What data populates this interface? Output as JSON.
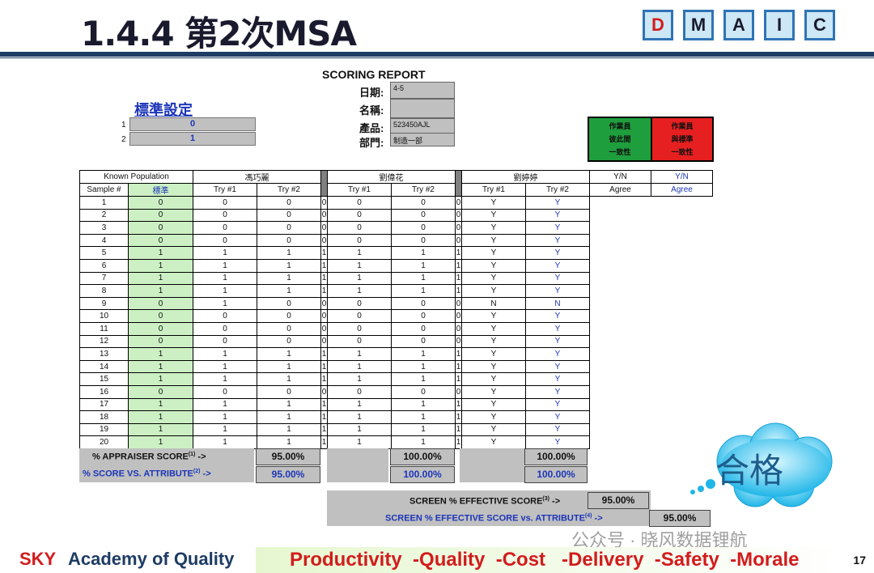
{
  "slide": {
    "title": "1.4.4 第2次MSA",
    "dmaic": [
      "D",
      "M",
      "A",
      "I",
      "C"
    ],
    "page_number": "17"
  },
  "report": {
    "heading": "SCORING REPORT",
    "date_label": "日期:",
    "date_value": "4-5",
    "name_label": "名稱:",
    "name_value": "",
    "product_label": "產品:",
    "product_value": "523450AJL",
    "dept_label": "部門:",
    "dept_value": "制造一部"
  },
  "standard": {
    "title": "標準設定",
    "rows": [
      {
        "index": "1",
        "value": "0"
      },
      {
        "index": "2",
        "value": "1"
      }
    ]
  },
  "legend": {
    "agree": "作業員\n彼此間\n一致性",
    "vs_standard": "作業員\n與標準\n一致性"
  },
  "table": {
    "known_population": "Known Population",
    "sample_header": "Sample #",
    "standard_header": "標準",
    "appraisers": [
      "馮巧麗",
      "劉偉花",
      "劉婷婷"
    ],
    "try1": "Try #1",
    "try2": "Try #2",
    "yn_header": "Y/N",
    "agree_header": "Agree",
    "rows": [
      [
        "1",
        "0",
        "0",
        "0",
        "0",
        "0",
        "0",
        "0",
        "Y",
        "Y"
      ],
      [
        "2",
        "0",
        "0",
        "0",
        "0",
        "0",
        "0",
        "0",
        "Y",
        "Y"
      ],
      [
        "3",
        "0",
        "0",
        "0",
        "0",
        "0",
        "0",
        "0",
        "Y",
        "Y"
      ],
      [
        "4",
        "0",
        "0",
        "0",
        "0",
        "0",
        "0",
        "0",
        "Y",
        "Y"
      ],
      [
        "5",
        "1",
        "1",
        "1",
        "1",
        "1",
        "1",
        "1",
        "Y",
        "Y"
      ],
      [
        "6",
        "1",
        "1",
        "1",
        "1",
        "1",
        "1",
        "1",
        "Y",
        "Y"
      ],
      [
        "7",
        "1",
        "1",
        "1",
        "1",
        "1",
        "1",
        "1",
        "Y",
        "Y"
      ],
      [
        "8",
        "1",
        "1",
        "1",
        "1",
        "1",
        "1",
        "1",
        "Y",
        "Y"
      ],
      [
        "9",
        "0",
        "1",
        "0",
        "0",
        "0",
        "0",
        "0",
        "N",
        "N"
      ],
      [
        "10",
        "0",
        "0",
        "0",
        "0",
        "0",
        "0",
        "0",
        "Y",
        "Y"
      ],
      [
        "11",
        "0",
        "0",
        "0",
        "0",
        "0",
        "0",
        "0",
        "Y",
        "Y"
      ],
      [
        "12",
        "0",
        "0",
        "0",
        "0",
        "0",
        "0",
        "0",
        "Y",
        "Y"
      ],
      [
        "13",
        "1",
        "1",
        "1",
        "1",
        "1",
        "1",
        "1",
        "Y",
        "Y"
      ],
      [
        "14",
        "1",
        "1",
        "1",
        "1",
        "1",
        "1",
        "1",
        "Y",
        "Y"
      ],
      [
        "15",
        "1",
        "1",
        "1",
        "1",
        "1",
        "1",
        "1",
        "Y",
        "Y"
      ],
      [
        "16",
        "0",
        "0",
        "0",
        "0",
        "0",
        "0",
        "0",
        "Y",
        "Y"
      ],
      [
        "17",
        "1",
        "1",
        "1",
        "1",
        "1",
        "1",
        "1",
        "Y",
        "Y"
      ],
      [
        "18",
        "1",
        "1",
        "1",
        "1",
        "1",
        "1",
        "1",
        "Y",
        "Y"
      ],
      [
        "19",
        "1",
        "1",
        "1",
        "1",
        "1",
        "1",
        "1",
        "Y",
        "Y"
      ],
      [
        "20",
        "1",
        "1",
        "1",
        "1",
        "1",
        "1",
        "1",
        "Y",
        "Y"
      ]
    ]
  },
  "scores": {
    "appraiser_label": "% APPRAISER SCORE",
    "appraiser_sup": "(1)",
    "attribute_label": "% SCORE VS. ATTRIBUTE",
    "attribute_sup": "(2)",
    "arrow": " ->",
    "appraiser_values": [
      "95.00%",
      "100.00%",
      "100.00%"
    ],
    "attribute_values": [
      "95.00%",
      "100.00%",
      "100.00%"
    ],
    "screen_label": "SCREEN % EFFECTIVE SCORE",
    "screen_sup": "(3)",
    "screen_value": "95.00%",
    "screen_attr_label": "SCREEN % EFFECTIVE SCORE vs. ATTRIBUTE",
    "screen_attr_sup": "(4)",
    "screen_attr_value": "95.00%"
  },
  "callout": "合格",
  "footer": {
    "sky": "SKY",
    "academy": "Academy of Quality",
    "motto": "Productivity  -Quality  -Cost   -Delivery  -Safety  -Morale",
    "watermark": "公众号 · 晓风数据锂航"
  },
  "colors": {
    "navy": "#1e3c64",
    "red": "#d21c1c",
    "blue": "#1d36b8",
    "green_cell": "#ccf0c4",
    "gray_cell": "#c0c0c0"
  }
}
